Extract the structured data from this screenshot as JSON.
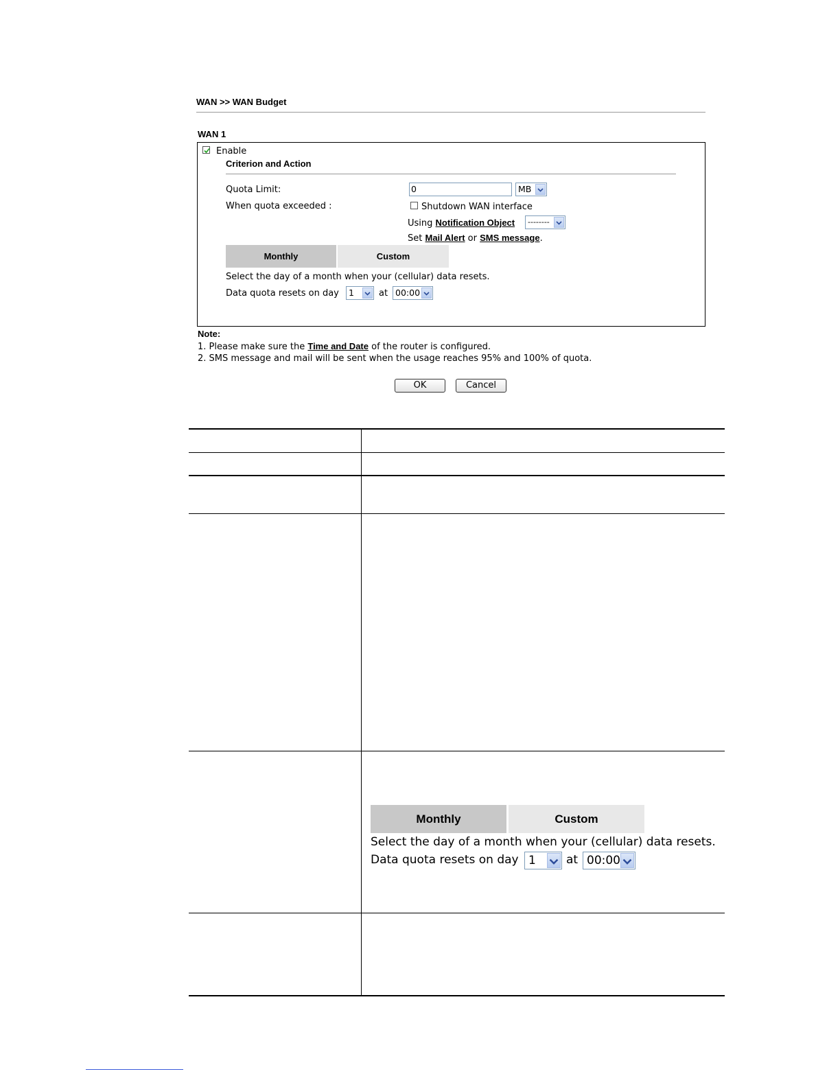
{
  "breadcrumb": "WAN >> WAN Budget",
  "section_title": "WAN 1",
  "enable": {
    "label": "Enable",
    "checked": true
  },
  "criterion_title": "Criterion and Action",
  "quota_limit": {
    "label": "Quota Limit:",
    "value": "0",
    "unit": "MB"
  },
  "quota_exceeded": {
    "label": "When quota exceeded :",
    "shutdown_label": "Shutdown WAN interface",
    "shutdown_checked": false,
    "using_prefix": "Using",
    "notification_link": "Notification Object",
    "notification_value": "--------",
    "set_prefix": "Set",
    "mail_alert_link": "Mail Alert",
    "or_text": "or",
    "sms_link": "SMS message",
    "period": "."
  },
  "tabs": {
    "monthly": "Monthly",
    "custom": "Custom"
  },
  "reset": {
    "description": "Select the day of a month when your (cellular) data resets.",
    "label": "Data quota resets on day",
    "day": "1",
    "at": "at",
    "time": "00:00"
  },
  "note": {
    "title": "Note:",
    "line1_prefix": "1. Please make sure the",
    "line1_link": "Time and Date",
    "line1_suffix": "of the router is configured.",
    "line2": "2. SMS message and mail will be sent when the usage reaches 95% and 100% of quota."
  },
  "buttons": {
    "ok": "OK",
    "cancel": "Cancel"
  }
}
